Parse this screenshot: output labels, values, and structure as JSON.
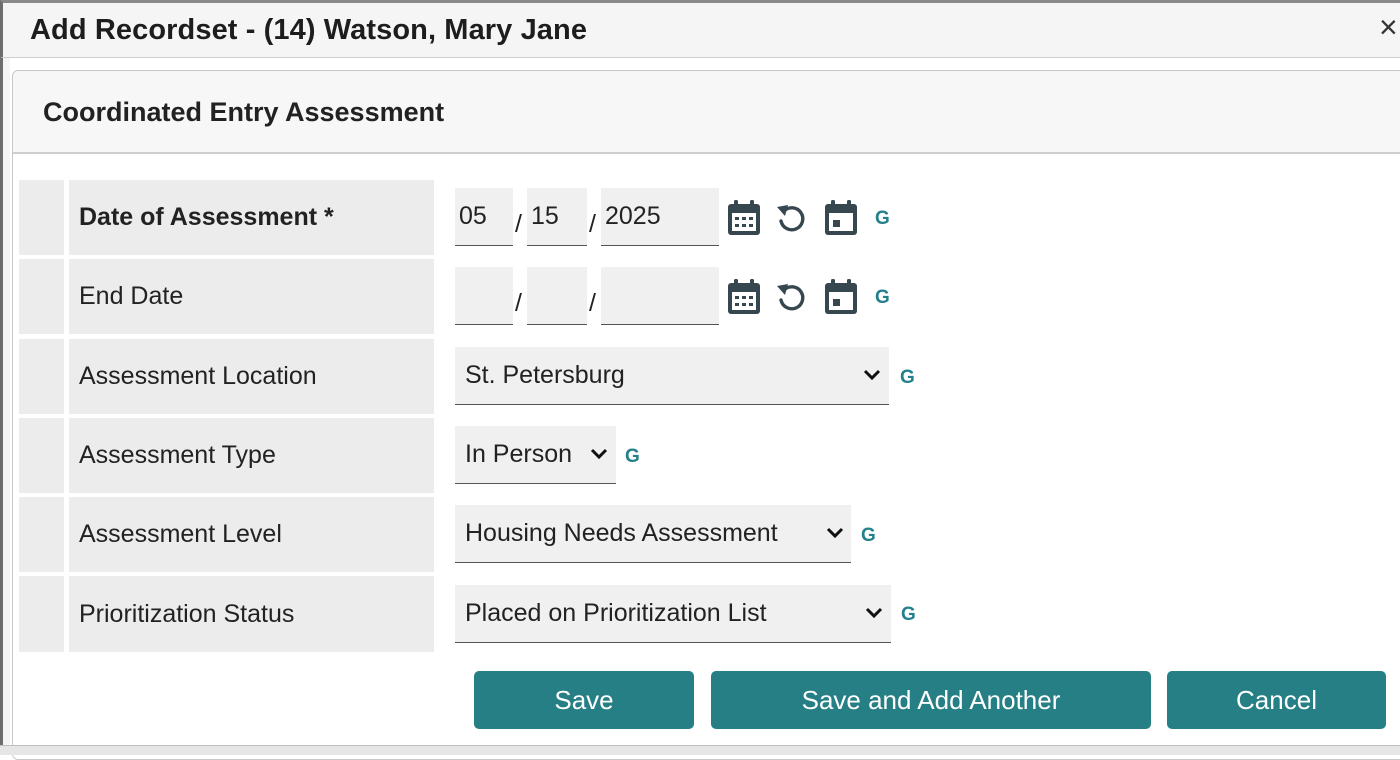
{
  "dialog": {
    "title": "Add Recordset - (14) Watson, Mary Jane",
    "close_glyph": "×"
  },
  "section": {
    "title": "Coordinated Entry Assessment"
  },
  "fields": {
    "date_of_assessment": {
      "label": "Date of Assessment *",
      "month": "05",
      "day": "15",
      "year": "2025",
      "separator": "/",
      "icons": [
        "calendar-icon",
        "reset-icon",
        "today-icon"
      ],
      "g": "G"
    },
    "end_date": {
      "label": "End Date",
      "month": "",
      "day": "",
      "year": "",
      "separator": "/",
      "g": "G"
    },
    "assessment_location": {
      "label": "Assessment Location",
      "value": "St. Petersburg",
      "g": "G"
    },
    "assessment_type": {
      "label": "Assessment Type",
      "value": "In Person",
      "g": "G"
    },
    "assessment_level": {
      "label": "Assessment Level",
      "value": "Housing Needs Assessment",
      "g": "G"
    },
    "prioritization_status": {
      "label": "Prioritization Status",
      "value": "Placed on Prioritization List",
      "g": "G"
    }
  },
  "buttons": {
    "save": "Save",
    "save_add_another": "Save and Add Another",
    "cancel": "Cancel"
  },
  "colors": {
    "accent": "#257f84",
    "g_link": "#24808a",
    "icon": "#37474f",
    "label_bg": "#ececec",
    "input_bg": "#f0f0f0"
  }
}
